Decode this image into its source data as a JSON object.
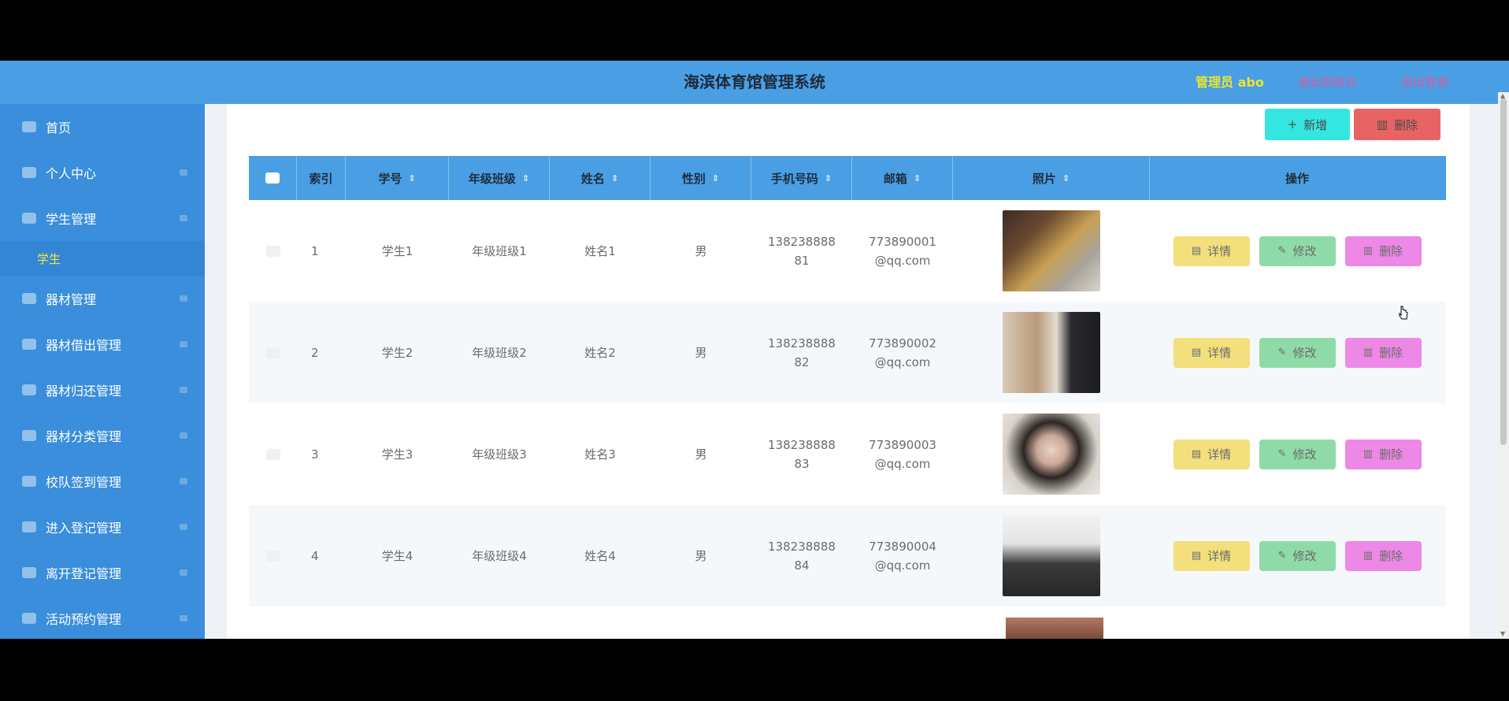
{
  "header": {
    "title": "海滨体育馆管理系统",
    "user": "管理员 abo",
    "link1": "退出到前台",
    "link2": "退出登录"
  },
  "sidebar": {
    "items": [
      {
        "label": "首页",
        "icon": "home-icon"
      },
      {
        "label": "个人中心",
        "icon": "user-icon"
      },
      {
        "label": "学生管理",
        "icon": "students-icon"
      },
      {
        "label": "器材管理",
        "icon": "equipment-icon"
      },
      {
        "label": "器材借出管理",
        "icon": "lend-icon"
      },
      {
        "label": "器材归还管理",
        "icon": "return-icon"
      },
      {
        "label": "器材分类管理",
        "icon": "category-icon"
      },
      {
        "label": "校队签到管理",
        "icon": "checkin-icon"
      },
      {
        "label": "进入登记管理",
        "icon": "enter-icon"
      },
      {
        "label": "离开登记管理",
        "icon": "leave-icon"
      },
      {
        "label": "活动预约管理",
        "icon": "reserve-icon"
      }
    ],
    "sub_item": "学生"
  },
  "toolbar": {
    "add_label": "新增",
    "delete_label": "删除"
  },
  "table": {
    "columns": [
      "索引",
      "学号",
      "年级班级",
      "姓名",
      "性别",
      "手机号码",
      "邮箱",
      "照片",
      "操作"
    ],
    "rows": [
      {
        "index": "1",
        "student_id": "学生1",
        "grade_class": "年级班级1",
        "name": "姓名1",
        "gender": "男",
        "phone_a": "138238888",
        "phone_b": "81",
        "email_a": "773890001",
        "email_b": "@qq.com"
      },
      {
        "index": "2",
        "student_id": "学生2",
        "grade_class": "年级班级2",
        "name": "姓名2",
        "gender": "男",
        "phone_a": "138238888",
        "phone_b": "82",
        "email_a": "773890002",
        "email_b": "@qq.com"
      },
      {
        "index": "3",
        "student_id": "学生3",
        "grade_class": "年级班级3",
        "name": "姓名3",
        "gender": "男",
        "phone_a": "138238888",
        "phone_b": "83",
        "email_a": "773890003",
        "email_b": "@qq.com"
      },
      {
        "index": "4",
        "student_id": "学生4",
        "grade_class": "年级班级4",
        "name": "姓名4",
        "gender": "男",
        "phone_a": "138238888",
        "phone_b": "84",
        "email_a": "773890004",
        "email_b": "@qq.com"
      }
    ],
    "actions": {
      "detail": "详情",
      "edit": "修改",
      "delete": "删除"
    }
  },
  "colors": {
    "header_bg": "#4a9fe4",
    "sidebar_bg": "#3a8edb",
    "accent_yellow": "#f3e93b",
    "btn_add": "#34e6e0",
    "btn_del": "#e86464",
    "op_detail": "#f3df7c",
    "op_edit": "#8fdba7",
    "op_delete": "#ee88e6"
  }
}
